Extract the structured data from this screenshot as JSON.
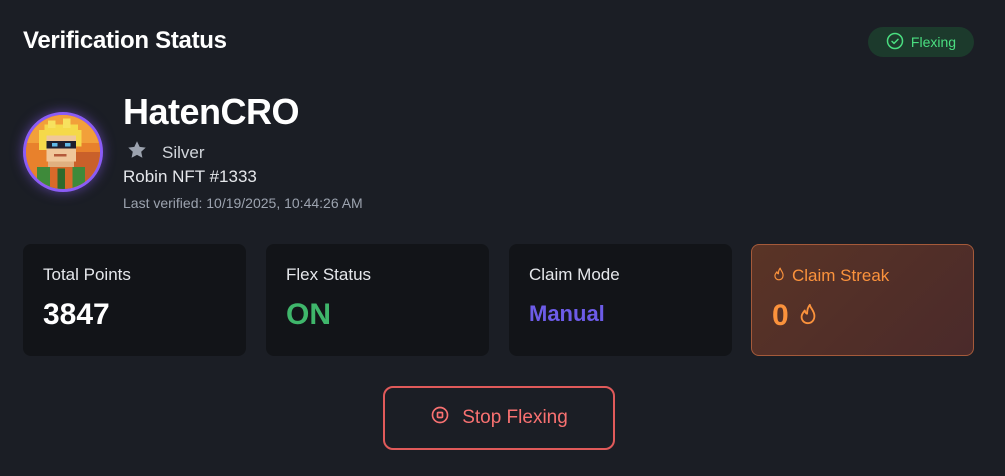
{
  "header": {
    "title": "Verification Status",
    "badge": {
      "label": "Flexing",
      "icon": "check-circle-icon",
      "color": "#4ade80"
    }
  },
  "profile": {
    "username": "HatenCRO",
    "tier": {
      "label": "Silver",
      "icon": "star-icon"
    },
    "nft": "Robin NFT #1333",
    "last_verified": "Last verified: 10/19/2025, 10:44:26 AM",
    "avatar": "pixel-art-avatar"
  },
  "stats": [
    {
      "label": "Total Points",
      "value": "3847"
    },
    {
      "label": "Flex Status",
      "value": "ON",
      "color": "#3fb66b"
    },
    {
      "label": "Claim Mode",
      "value": "Manual",
      "color": "#6d5ce8"
    },
    {
      "label": "Claim Streak",
      "value": "0",
      "icon": "flame-icon",
      "color": "#fb923c"
    }
  ],
  "actions": {
    "stop_label": "Stop Flexing",
    "stop_icon": "stop-circle-icon",
    "color": "#f87171"
  }
}
